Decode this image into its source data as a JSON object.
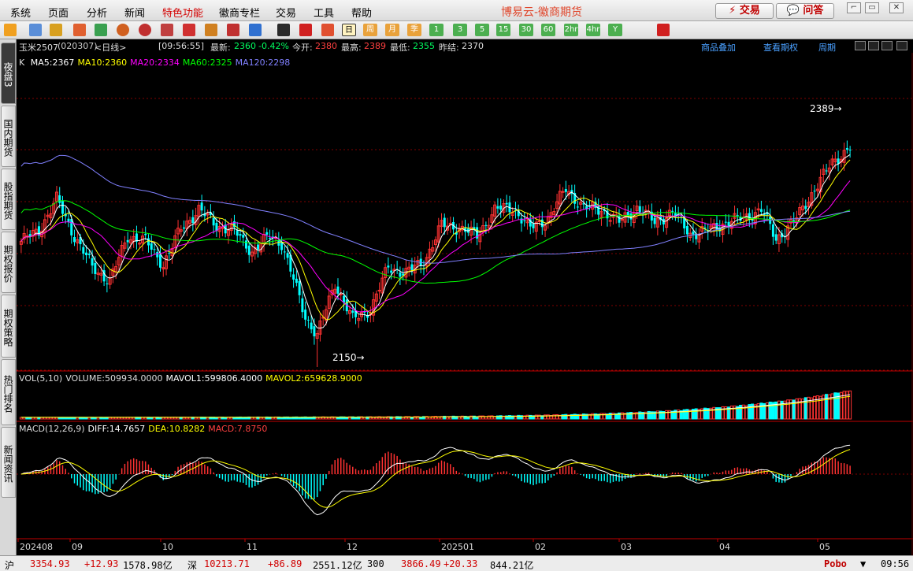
{
  "menubar": {
    "items": [
      "系统",
      "页面",
      "分析",
      "新闻",
      "特色功能",
      "徽商专栏",
      "交易",
      "工具",
      "帮助"
    ],
    "highlight_index": 4,
    "app_title": "博易云-徽商期货",
    "trade_button": "交易",
    "qa_button": "问答"
  },
  "toolbar": {
    "periods": [
      "日",
      "周",
      "月",
      "季",
      "1",
      "3",
      "5",
      "15",
      "30",
      "60",
      "2hr",
      "4hr",
      "Y"
    ],
    "selected_period": "日",
    "icons": [
      "back-icon",
      "folder-icon",
      "save-icon",
      "news-icon",
      "refresh-icon",
      "search-icon",
      "zoom-icon",
      "window-icon",
      "pen-icon",
      "alert-icon",
      "filter-icon",
      "new-icon",
      "table-icon",
      "trend-icon",
      "tick-icon"
    ]
  },
  "left_tabs": [
    "夜盘3",
    "国内期货",
    "股指期货",
    "期权报价",
    "期权策略",
    "热门排名",
    "新闻资讯"
  ],
  "infobar": {
    "contract": "玉米2507",
    "code": "(020307)",
    "period": "<日线>",
    "time": "[09:56:55]",
    "latest_label": "最新:",
    "latest": "2360",
    "change": "-0.42%",
    "open_label": "今开:",
    "open": "2380",
    "high_label": "最高:",
    "high": "2389",
    "low_label": "最低:",
    "low": "2355",
    "prev_settle_label": "昨结:",
    "prev_settle": "2370",
    "links": [
      "商品叠加",
      "查看期权",
      "周期"
    ]
  },
  "ma_legend": {
    "prefix": "K",
    "items": [
      {
        "text": "MA5:2367",
        "color": "#ffffff"
      },
      {
        "text": "MA10:2360",
        "color": "#ffff00"
      },
      {
        "text": "MA20:2334",
        "color": "#ff00ff"
      },
      {
        "text": "MA60:2325",
        "color": "#00ff00"
      },
      {
        "text": "MA120:2298",
        "color": "#8080ff"
      }
    ]
  },
  "vol_legend": {
    "items": [
      {
        "text": "VOL(5,10)",
        "color": "#dddddd"
      },
      {
        "text": "VOLUME:509934.0000",
        "color": "#dddddd"
      },
      {
        "text": "MAVOL1:599806.4000",
        "color": "#ffffff"
      },
      {
        "text": "MAVOL2:659628.9000",
        "color": "#ffff00"
      }
    ]
  },
  "macd_legend": {
    "items": [
      {
        "text": "MACD(12,26,9)",
        "color": "#dddddd"
      },
      {
        "text": "DIFF:14.7657",
        "color": "#ffffff"
      },
      {
        "text": "DEA:10.8282",
        "color": "#ffff00"
      },
      {
        "text": "MACD:7.8750",
        "color": "#ff4040"
      }
    ]
  },
  "price_labels": {
    "high": "2389",
    "low": "2150"
  },
  "x_labels": [
    "202408",
    "09",
    "10",
    "11",
    "12",
    "202501",
    "02",
    "03",
    "04",
    "05"
  ],
  "colors": {
    "up": "#ff3232",
    "down": "#00ffff",
    "grid": "#800000",
    "background": "#000000"
  },
  "chart_data": {
    "type": "candlestick",
    "price_range": [
      2150,
      2389
    ],
    "series": [
      {
        "name": "MA5",
        "last": 2367
      },
      {
        "name": "MA10",
        "last": 2360
      },
      {
        "name": "MA20",
        "last": 2334
      },
      {
        "name": "MA60",
        "last": 2325
      },
      {
        "name": "MA120",
        "last": 2298
      }
    ],
    "anchors": [
      [
        0,
        2270
      ],
      [
        6,
        2280
      ],
      [
        12,
        2310
      ],
      [
        18,
        2275
      ],
      [
        24,
        2245
      ],
      [
        30,
        2232
      ],
      [
        36,
        2275
      ],
      [
        42,
        2270
      ],
      [
        48,
        2248
      ],
      [
        54,
        2282
      ],
      [
        60,
        2300
      ],
      [
        66,
        2285
      ],
      [
        72,
        2280
      ],
      [
        78,
        2260
      ],
      [
        84,
        2275
      ],
      [
        88,
        2268
      ],
      [
        96,
        2198
      ],
      [
        100,
        2180
      ],
      [
        106,
        2230
      ],
      [
        112,
        2195
      ],
      [
        118,
        2205
      ],
      [
        124,
        2245
      ],
      [
        130,
        2240
      ],
      [
        136,
        2250
      ],
      [
        142,
        2285
      ],
      [
        148,
        2283
      ],
      [
        154,
        2275
      ],
      [
        160,
        2300
      ],
      [
        166,
        2302
      ],
      [
        172,
        2282
      ],
      [
        178,
        2292
      ],
      [
        184,
        2320
      ],
      [
        190,
        2302
      ],
      [
        196,
        2300
      ],
      [
        202,
        2288
      ],
      [
        208,
        2302
      ],
      [
        214,
        2288
      ],
      [
        220,
        2298
      ],
      [
        226,
        2277
      ],
      [
        232,
        2280
      ],
      [
        238,
        2288
      ],
      [
        244,
        2292
      ],
      [
        250,
        2300
      ],
      [
        255,
        2272
      ],
      [
        262,
        2292
      ],
      [
        268,
        2320
      ],
      [
        274,
        2345
      ],
      [
        278,
        2355
      ],
      [
        280,
        2360
      ]
    ],
    "volume_last": 509934,
    "macd": {
      "diff": 14.7657,
      "dea": 10.8282,
      "macd": 7.875
    }
  },
  "statusbar": {
    "sh_label": "沪",
    "sh_index": "3354.93",
    "sh_change": "+12.93",
    "sh_amount": "1578.98亿",
    "sz_label": "深",
    "sz_index": "10213.71",
    "sz_change": "+86.89",
    "sz_amount": "2551.12亿",
    "cy_label": "300",
    "cy_index": "3866.49",
    "cy_change": "+20.33",
    "cy_amount": "844.21亿",
    "brand": "Pobo",
    "clock": "09:56"
  }
}
